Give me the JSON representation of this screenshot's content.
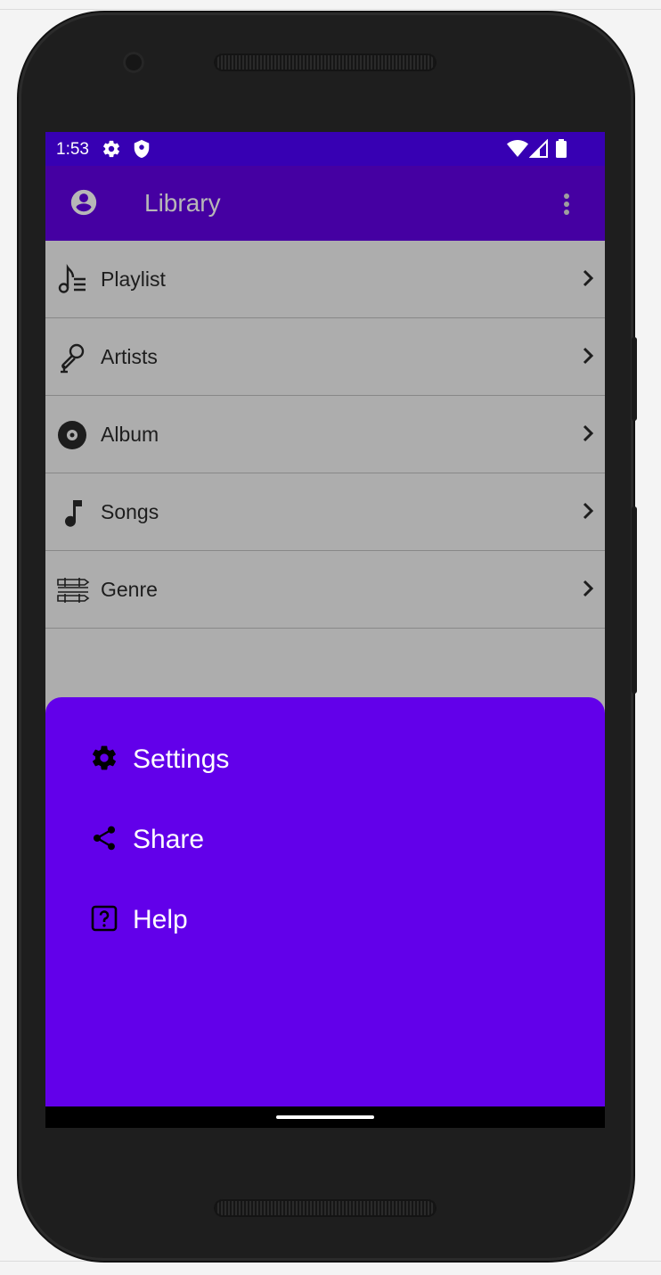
{
  "status_bar": {
    "time": "1:53",
    "icons": [
      "gear-icon",
      "shield-icon",
      "wifi-icon",
      "signal-icon",
      "battery-icon"
    ]
  },
  "app_bar": {
    "title": "Library",
    "leading_icon": "account-circle-icon",
    "trailing_icon": "more-vert-icon"
  },
  "library_items": [
    {
      "label": "Playlist",
      "icon": "playlist-icon"
    },
    {
      "label": "Artists",
      "icon": "microphone-icon"
    },
    {
      "label": "Album",
      "icon": "album-icon"
    },
    {
      "label": "Songs",
      "icon": "music-note-icon"
    },
    {
      "label": "Genre",
      "icon": "genre-icon"
    }
  ],
  "bottom_sheet": {
    "items": [
      {
        "label": "Settings",
        "icon": "gear-icon"
      },
      {
        "label": "Share",
        "icon": "share-icon"
      },
      {
        "label": "Help",
        "icon": "help-icon"
      }
    ]
  },
  "colors": {
    "status_bar": "#3700b3",
    "app_bar": "#4500a2",
    "sheet": "#6200ea",
    "scrim_list": "#adadad"
  }
}
